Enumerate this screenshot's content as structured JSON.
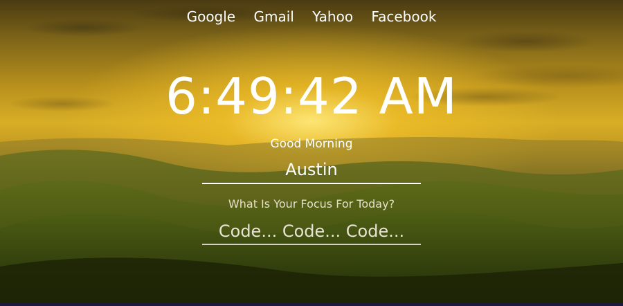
{
  "nav": {
    "links": [
      {
        "label": "Google"
      },
      {
        "label": "Gmail"
      },
      {
        "label": "Yahoo"
      },
      {
        "label": "Facebook"
      }
    ]
  },
  "clock": {
    "time": "6:49:42 AM"
  },
  "greeting": {
    "text": "Good Morning"
  },
  "name_input": {
    "value": "Austin"
  },
  "focus": {
    "question": "What Is Your Focus For Today?",
    "value": "Code... Code... Code..."
  },
  "theme": {
    "text_color": "#ffffff",
    "sky_glow": "#d7ae26",
    "hill_green": "#4d5a16"
  }
}
